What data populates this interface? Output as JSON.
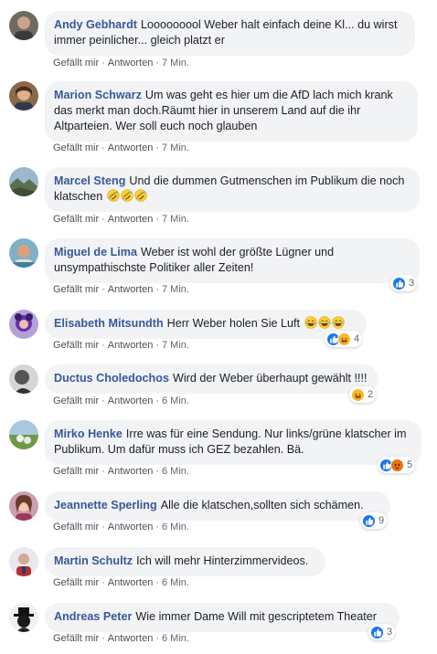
{
  "comments": [
    {
      "author": "Andy Gebhardt",
      "text": "Looooooool Weber halt einfach deine Kl... du wirst immer peinlicher... gleich platzt er",
      "like": "Gefällt mir",
      "reply": "Antworten",
      "time": "7 Min."
    },
    {
      "author": "Marion Schwarz",
      "text": "Um was geht es hier um die AfD lach mich krank das merkt man doch.Räumt hier in unserem Land auf die ihr Altparteien. Wer soll euch noch glauben",
      "like": "Gefällt mir",
      "reply": "Antworten",
      "time": "7 Min."
    },
    {
      "author": "Marcel Steng",
      "text": "Und die dummen Gutmenschen im Publikum die noch klatschen",
      "emoji": "rofl-emoji",
      "like": "Gefällt mir",
      "reply": "Antworten",
      "time": "7 Min."
    },
    {
      "author": "Miguel de Lima",
      "text": "Weber ist wohl der größte Lügner und unsympathischste Politiker aller Zeiten!",
      "like": "Gefällt mir",
      "reply": "Antworten",
      "time": "7 Min.",
      "reaction_count": "3"
    },
    {
      "author": "Elisabeth Mitsundth",
      "text": "Herr Weber holen Sie Luft",
      "emoji": "laughing-emoji",
      "like": "Gefällt mir",
      "reply": "Antworten",
      "time": "7 Min.",
      "reaction_count": "4"
    },
    {
      "author": "Ductus Choledochos",
      "text": "Wird der Weber überhaupt gewählt !!!!",
      "like": "Gefällt mir",
      "reply": "Antworten",
      "time": "6 Min.",
      "reaction_count": "2"
    },
    {
      "author": "Mirko Henke",
      "text": "Irre was für eine Sendung. Nur links/grüne klatscher im Publikum. Um dafür muss ich GEZ bezahlen. Bä.",
      "like": "Gefällt mir",
      "reply": "Antworten",
      "time": "6 Min.",
      "reaction_count": "5"
    },
    {
      "author": "Jeannette Sperling",
      "text": "Alle die klatschen,sollten sich schämen.",
      "like": "Gefällt mir",
      "reply": "Antworten",
      "time": "6 Min.",
      "reaction_count": "9"
    },
    {
      "author": "Martin Schultz",
      "text": "Ich will mehr Hinterzimmervideos.",
      "like": "Gefällt mir",
      "reply": "Antworten",
      "time": "6 Min."
    },
    {
      "author": "Andreas Peter",
      "text": "Wie immer Dame Will mit gescriptetem Theater",
      "like": "Gefällt mir",
      "reply": "Antworten",
      "time": "6 Min.",
      "reaction_count": "3"
    }
  ],
  "ui": {
    "separator": "·"
  },
  "colors": {
    "author": "#385898",
    "bubble": "#f2f3f5",
    "like": "#1877f2",
    "haha": "#f7b928",
    "angry": "#e9710f"
  }
}
